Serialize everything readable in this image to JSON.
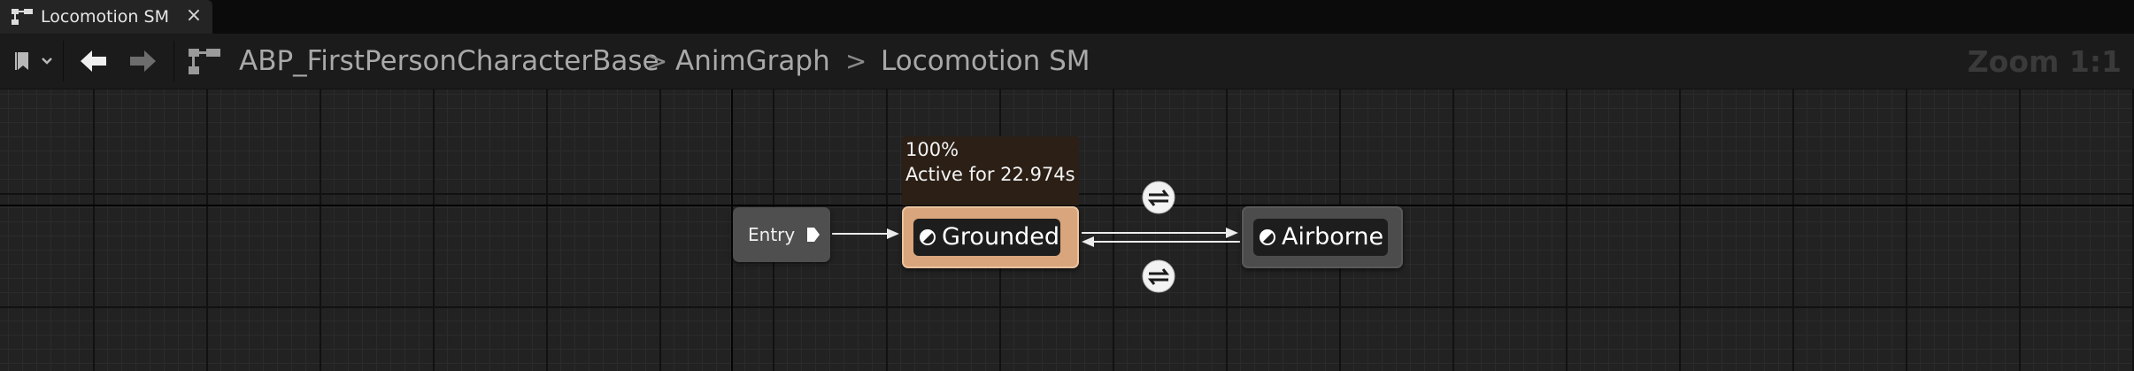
{
  "tab": {
    "title": "Locomotion SM",
    "icon": "state-machine-icon",
    "close_glyph": "×"
  },
  "toolbar": {
    "bookmark_icon": "bookmark-icon",
    "back_icon": "back-arrow-icon",
    "forward_icon": "forward-arrow-icon",
    "graph_icon": "state-machine-icon",
    "breadcrumbs": [
      {
        "label": "ABP_FirstPersonCharacterBase"
      },
      {
        "label": "AnimGraph"
      },
      {
        "label": "Locomotion SM"
      }
    ],
    "separator": ">",
    "zoom_label": "Zoom 1:1"
  },
  "graph": {
    "entry_label": "Entry",
    "states": [
      {
        "name": "Grounded",
        "active": true,
        "tooltip_weight": "100%",
        "tooltip_time": "Active for 22.974s"
      },
      {
        "name": "Airborne",
        "active": false
      }
    ],
    "transitions": [
      {
        "from": "Grounded",
        "to": "Airborne",
        "icon": "transition-rule-icon"
      },
      {
        "from": "Airborne",
        "to": "Grounded",
        "icon": "transition-rule-icon"
      }
    ],
    "colors": {
      "active_state": "#d8a57c",
      "inactive_state": "#4c4c4c",
      "canvas": "#222222"
    }
  }
}
